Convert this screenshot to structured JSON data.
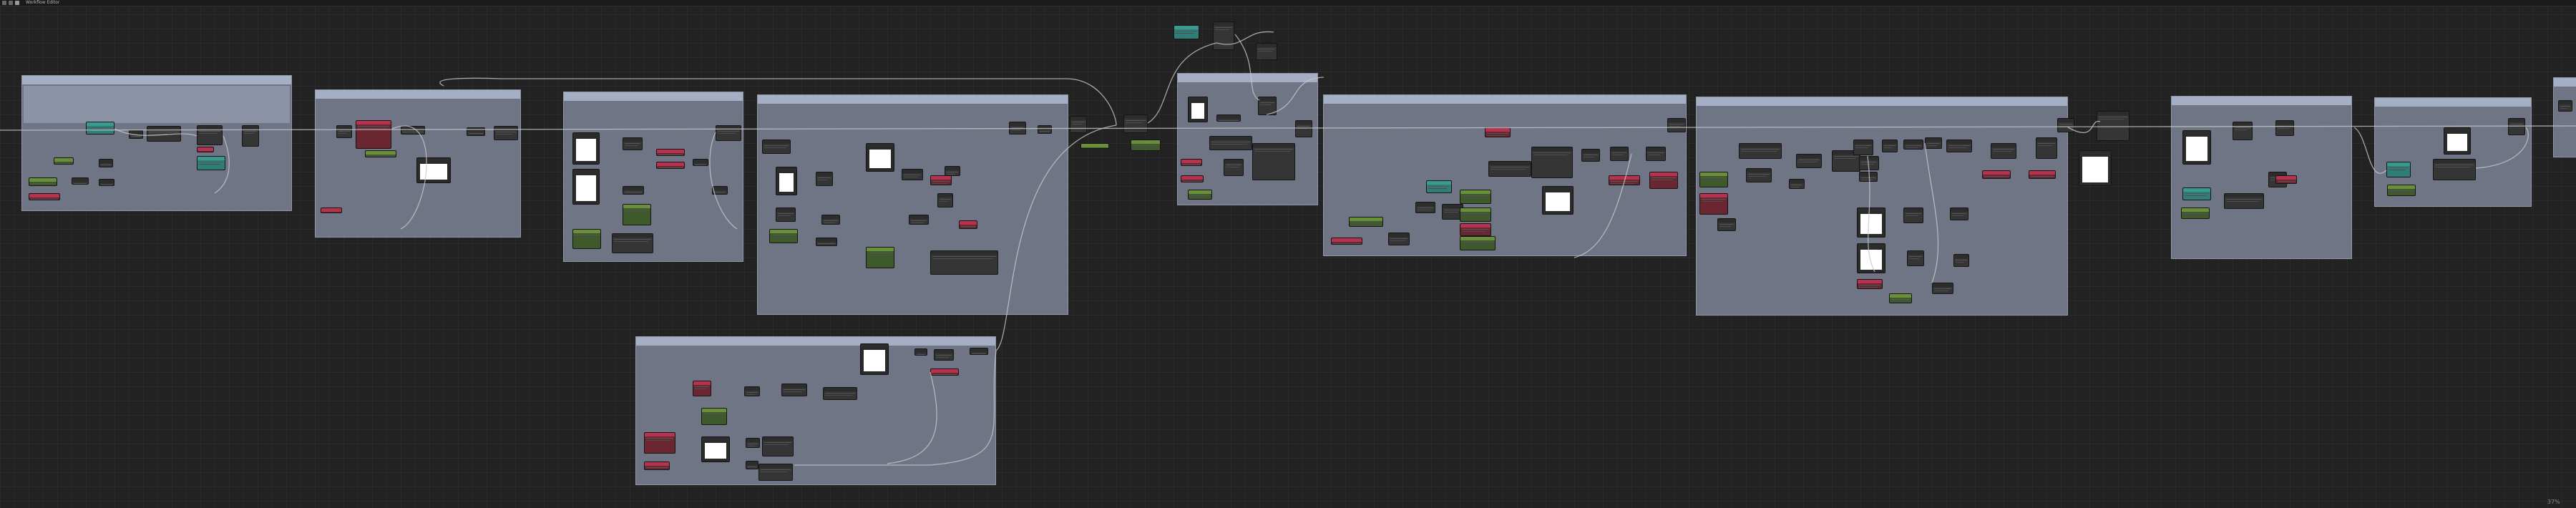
{
  "app": {
    "title": "Workflow Editor"
  },
  "canvas": {
    "zoom_label": "37%"
  },
  "groups": [
    {
      "id": "g1",
      "title": "",
      "has_note": true
    },
    {
      "id": "g2",
      "title": ""
    },
    {
      "id": "g3",
      "title": ""
    },
    {
      "id": "g4",
      "title": ""
    },
    {
      "id": "g5",
      "title": ""
    },
    {
      "id": "g6",
      "title": ""
    },
    {
      "id": "g7",
      "title": ""
    },
    {
      "id": "g8",
      "title": ""
    },
    {
      "id": "g9",
      "title": ""
    },
    {
      "id": "g10",
      "title": ""
    },
    {
      "id": "g11",
      "title": ""
    }
  ],
  "colors": {
    "canvas_bg": "#222222",
    "group_body": "#6f7585",
    "group_header": "#a4aec4",
    "node_body": "#353535",
    "node_teal": "#2f7f78",
    "node_green": "#6a8f3a",
    "node_red": "#b6324e",
    "node_yellow": "#c8a238",
    "wire": "#c8c8c8"
  },
  "icons": [
    "menu-icon",
    "app-icon"
  ]
}
